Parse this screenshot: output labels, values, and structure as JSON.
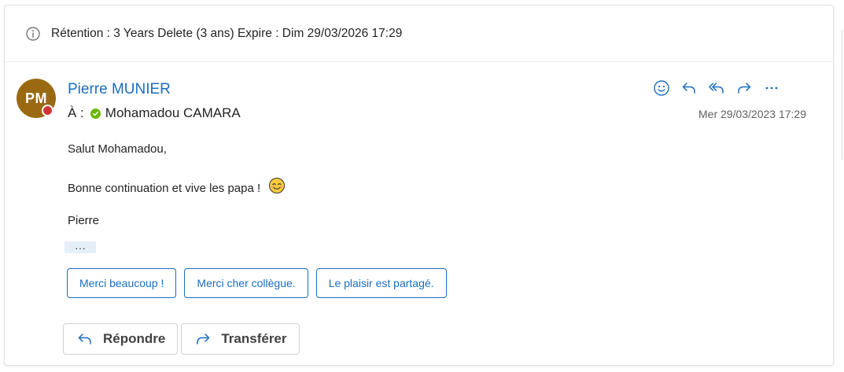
{
  "retention": {
    "text": "Rétention : 3 Years Delete (3 ans) Expire : Dim 29/03/2026 17:29",
    "icon": "info-icon"
  },
  "message": {
    "avatar_initials": "PM",
    "avatar_color": "#9a6a13",
    "presence_color": "#d13438",
    "sender": "Pierre MUNIER",
    "to_label": "À :",
    "recipient": "Mohamadou CAMARA",
    "recipient_status_color": "#6bb700",
    "date": "Mer 29/03/2023 17:29",
    "actions": [
      "emoji-reaction-icon",
      "reply-icon",
      "reply-all-icon",
      "forward-icon",
      "more-icon"
    ],
    "body": {
      "greeting": "Salut Mohamadou,",
      "line": "Bonne continuation et vive les papa !",
      "signature": "Pierre"
    },
    "show_more": "···"
  },
  "suggested_replies": [
    "Merci beaucoup !",
    "Merci cher collègue.",
    "Le plaisir est partagé."
  ],
  "footer": {
    "reply_label": "Répondre",
    "forward_label": "Transférer"
  },
  "colors": {
    "accent": "#1b6ec2",
    "text": "#242424",
    "muted": "#616161"
  }
}
